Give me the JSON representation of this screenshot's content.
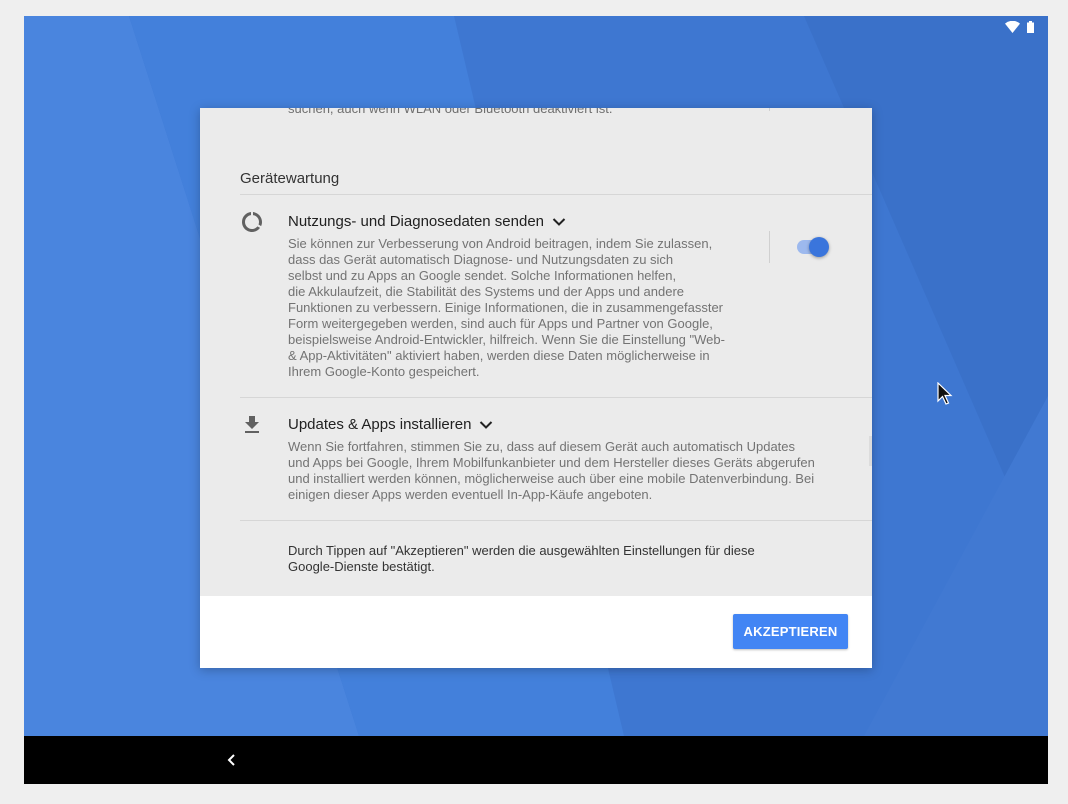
{
  "status_bar": {
    "wifi_icon": "wifi-icon",
    "battery_icon": "battery-icon"
  },
  "dialog": {
    "cut_off_text": "suchen, auch wenn WLAN oder Bluetooth deaktiviert ist.",
    "section_heading": "Gerätewartung",
    "items": [
      {
        "icon": "usage-diagnostics-icon",
        "title": "Nutzungs- und Diagnosedaten senden",
        "description": "Sie können zur Verbesserung von Android beitragen, indem Sie zulassen,\ndass das Gerät automatisch Diagnose- und Nutzungsdaten zu sich\nselbst und zu Apps an Google sendet.  Solche Informationen helfen,\ndie Akkulaufzeit, die Stabilität des Systems und der Apps und andere\nFunktionen zu verbessern. Einige Informationen, die in zusammengefasster\nForm weitergegeben werden, sind auch für Apps und Partner von Google,\nbeispielsweise Android-Entwickler, hilfreich. Wenn Sie die Einstellung \"Web-\n& App-Aktivitäten\" aktiviert haben, werden diese Daten möglicherweise in\nIhrem Google-Konto gespeichert.",
        "toggle_on": true
      },
      {
        "icon": "download-icon",
        "title": "Updates & Apps installieren",
        "description": "Wenn Sie fortfahren, stimmen Sie zu, dass auf diesem Gerät auch automatisch Updates\nund Apps bei Google, Ihrem Mobilfunkanbieter und dem Hersteller dieses Geräts abgerufen\nund installiert werden können, möglicherweise auch über eine mobile Datenverbindung. Bei\neinigen dieser Apps werden eventuell In-App-Käufe angeboten."
      }
    ],
    "consent_text": "Durch Tippen auf \"Akzeptieren\" werden die ausgewählten Einstellungen für diese\nGoogle-Dienste bestätigt.",
    "accept_label": "AKZEPTIEREN"
  },
  "navbar": {
    "back_icon": "back-chevron-icon"
  },
  "colors": {
    "wallpaper": "#3d76d0",
    "accent": "#4285f4",
    "toggle_thumb": "#3a75dc"
  }
}
